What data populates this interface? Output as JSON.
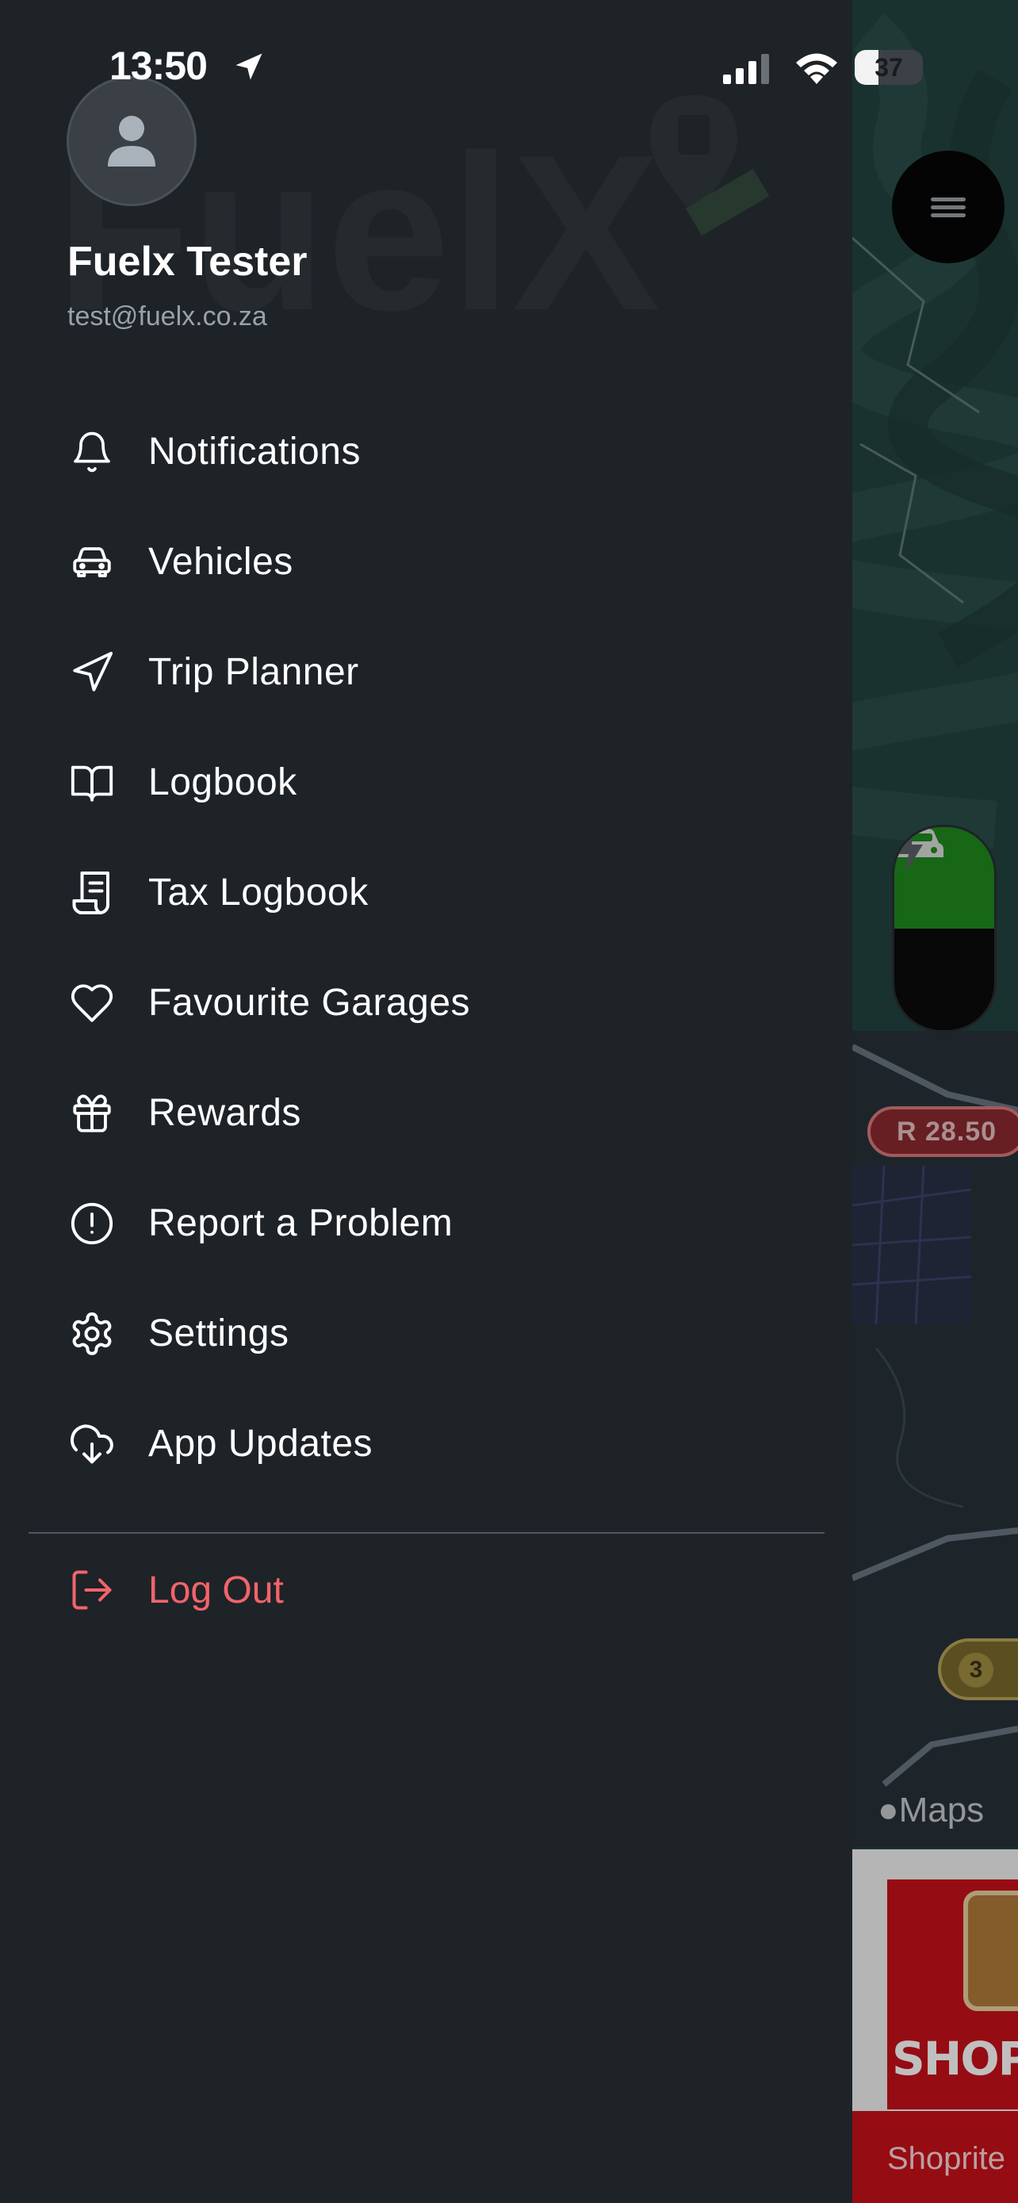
{
  "status_bar": {
    "time": "13:50",
    "battery": "37"
  },
  "profile": {
    "name": "Fuelx Tester",
    "email": "test@fuelx.co.za",
    "watermark": "FuelX"
  },
  "menu": {
    "items": [
      {
        "label": "Notifications",
        "icon": "bell-icon"
      },
      {
        "label": "Vehicles",
        "icon": "car-icon"
      },
      {
        "label": "Trip Planner",
        "icon": "navigation-arrow-icon"
      },
      {
        "label": "Logbook",
        "icon": "book-open-icon"
      },
      {
        "label": "Tax Logbook",
        "icon": "receipt-icon"
      },
      {
        "label": "Favourite Garages",
        "icon": "heart-icon"
      },
      {
        "label": "Rewards",
        "icon": "gift-icon"
      },
      {
        "label": "Report a Problem",
        "icon": "alert-circle-icon"
      },
      {
        "label": "Settings",
        "icon": "gear-icon"
      },
      {
        "label": "App Updates",
        "icon": "cloud-download-icon"
      }
    ],
    "logout_label": "Log Out"
  },
  "map": {
    "price_pill": "R 28.50",
    "cluster_count": "3",
    "maps_attribution": "Maps",
    "ad_brand": "SHOP",
    "ad_caption": "Shoprite"
  },
  "colors": {
    "drawer_bg": "#1e2328",
    "logout": "#f2646a",
    "fuel_toggle_active": "#1f8a1f"
  }
}
